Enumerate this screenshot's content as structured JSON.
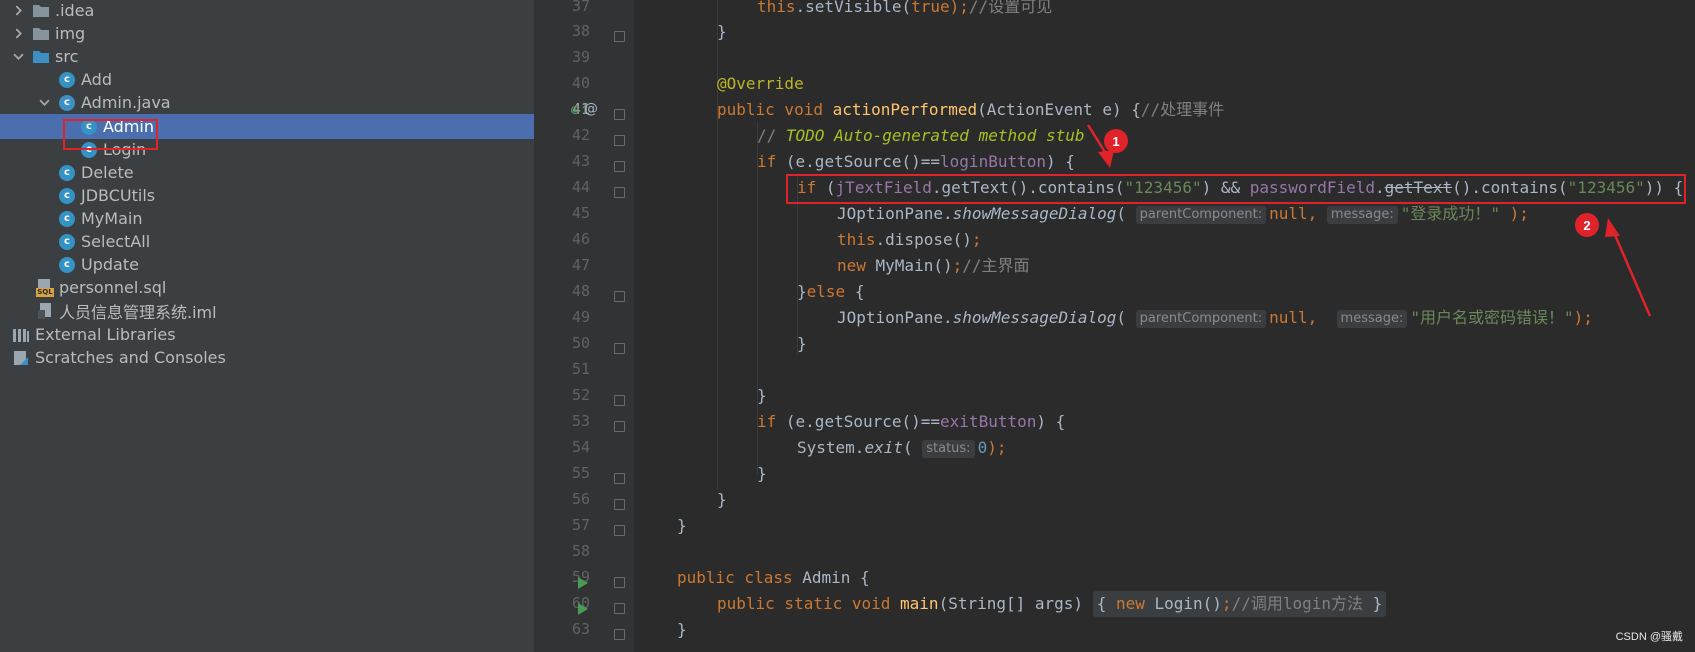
{
  "project_tree": {
    "items": [
      {
        "label": ".idea",
        "type": "folder",
        "arrow": "collapsed"
      },
      {
        "label": "img",
        "type": "folder",
        "arrow": "collapsed"
      },
      {
        "label": "src",
        "type": "folder",
        "arrow": "expanded"
      },
      {
        "label": "Add",
        "type": "class"
      },
      {
        "label": "Admin.java",
        "type": "java-file",
        "arrow": "expanded"
      },
      {
        "label": "Admin",
        "type": "class",
        "selected": true
      },
      {
        "label": "Login",
        "type": "class"
      },
      {
        "label": "Delete",
        "type": "class"
      },
      {
        "label": "JDBCUtils",
        "type": "class"
      },
      {
        "label": "MyMain",
        "type": "class"
      },
      {
        "label": "SelectAll",
        "type": "class"
      },
      {
        "label": "Update",
        "type": "class"
      },
      {
        "label": "personnel.sql",
        "type": "sql-file"
      },
      {
        "label": "人员信息管理系统.iml",
        "type": "iml-file"
      },
      {
        "label": "External Libraries",
        "type": "libraries"
      },
      {
        "label": "Scratches and Consoles",
        "type": "scratches"
      }
    ]
  },
  "editor": {
    "line_numbers": [
      "37",
      "38",
      "39",
      "40",
      "41",
      "42",
      "43",
      "44",
      "45",
      "46",
      "47",
      "48",
      "49",
      "50",
      "51",
      "52",
      "53",
      "54",
      "55",
      "56",
      "57",
      "58",
      "59",
      "60",
      "63"
    ],
    "current_line": "41",
    "code": {
      "l37": {
        "a": "this",
        "b": ".setVisible(",
        "c": "true",
        "d": ");",
        "e": "//设置可见"
      },
      "l38": {
        "a": "}"
      },
      "l40": {
        "a": "@Override"
      },
      "l41": {
        "a": "public void ",
        "b": "actionPerformed",
        "c": "(ActionEvent e) {",
        "d": "//处理事件"
      },
      "l42": {
        "a": "// ",
        "b": "TODO Auto-generated method stub"
      },
      "l43": {
        "a": "if ",
        "b": "(e.getSource()==",
        "c": "loginButton",
        "d": ") {"
      },
      "l44": {
        "a": "if ",
        "b": "(",
        "c": "jTextField",
        "d": ".getText().contains(",
        "e": "\"123456\"",
        "f": ") && ",
        "g": "passwordField",
        "h": ".",
        "i": "getText",
        "j": "().contains(",
        "k": "\"123456\"",
        "l": ")) {"
      },
      "l45": {
        "a": "JOptionPane.",
        "b": "showMessageDialog",
        "c": "( ",
        "h1": "parentComponent:",
        "d": "null",
        "e": ", ",
        "h2": "message:",
        "f": "\"登录成功！\" ",
        "g": ");"
      },
      "l46": {
        "a": "this",
        "b": ".dispose()",
        "c": ";"
      },
      "l47": {
        "a": "new ",
        "b": "MyMain()",
        "c": ";",
        "d": "//主界面"
      },
      "l48": {
        "a": "}",
        "b": "else ",
        "c": "{"
      },
      "l49": {
        "a": "JOptionPane.",
        "b": "showMessageDialog",
        "c": "( ",
        "h1": "parentComponent:",
        "d": "null",
        "e": ",  ",
        "h2": "message:",
        "f": "\"用户名或密码错误！\"",
        "g": ");"
      },
      "l50": {
        "a": "}"
      },
      "l52": {
        "a": "}"
      },
      "l53": {
        "a": "if ",
        "b": "(e.getSource()==",
        "c": "exitButton",
        "d": ") {"
      },
      "l54": {
        "a": "System.",
        "b": "exit",
        "c": "( ",
        "h1": "status:",
        "d": "0",
        "e": ");"
      },
      "l55": {
        "a": "}"
      },
      "l56": {
        "a": "}"
      },
      "l57": {
        "a": "}"
      },
      "l59": {
        "a": "public class ",
        "b": "Admin {"
      },
      "l60": {
        "a": "public static void ",
        "b": "main",
        "c": "(String[] args) ",
        "d": "{ ",
        "e": "new ",
        "f": "Login()",
        "g": ";",
        "h": "//调用login方法",
        "i": " }"
      },
      "l63": {
        "a": "}"
      }
    }
  },
  "annotations": {
    "marker_1": "1",
    "marker_2": "2",
    "box_color": "#e0222a"
  },
  "watermark": "CSDN @骚戴",
  "colors": {
    "tree_bg": "#3c3f41",
    "selection": "#4b6eaf",
    "editor_bg": "#2b2b2b",
    "gutter_bg": "#313335",
    "keyword": "#cc7832",
    "field": "#9876aa",
    "string": "#6a8759",
    "method": "#ffc66d",
    "annotation": "#bbb529",
    "comment": "#808080"
  }
}
